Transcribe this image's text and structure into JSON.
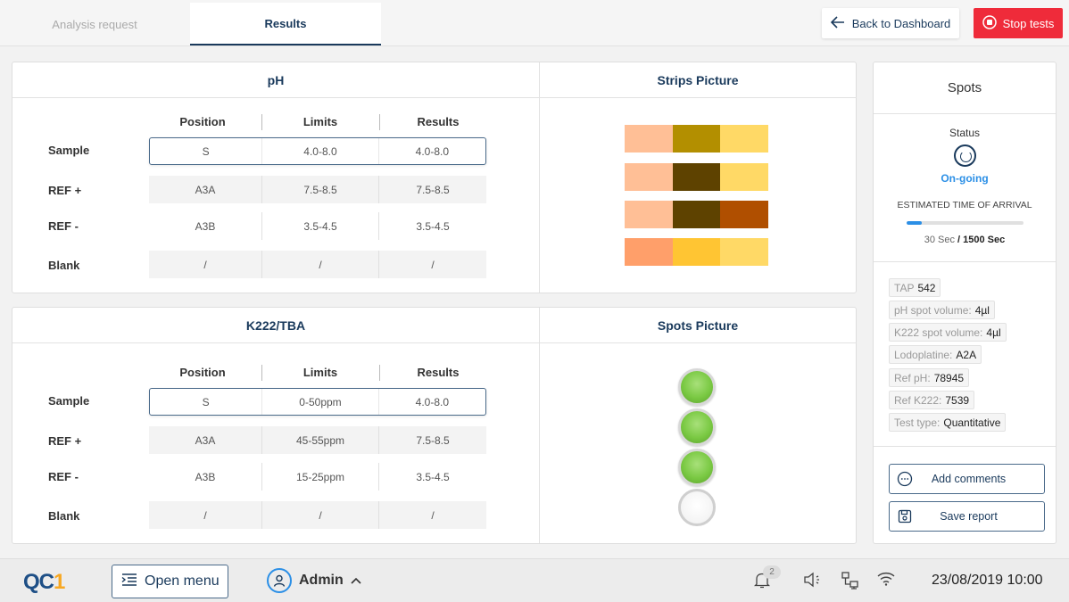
{
  "tabs": {
    "analysis_request": "Analysis request",
    "results": "Results"
  },
  "actions": {
    "back": "Back to Dashboard",
    "stop": "Stop tests"
  },
  "ph_panel": {
    "title": "pH",
    "picture_title": "Strips Picture",
    "columns": [
      "Position",
      "Limits",
      "Results"
    ],
    "rows": [
      {
        "label": "Sample",
        "position": "S",
        "limits": "4.0-8.0",
        "results": "4.0-8.0"
      },
      {
        "label": "REF +",
        "position": "A3A",
        "limits": "7.5-8.5",
        "results": "7.5-8.5"
      },
      {
        "label": "REF -",
        "position": "A3B",
        "limits": "3.5-4.5",
        "results": "3.5-4.5"
      },
      {
        "label": "Blank",
        "position": "/",
        "limits": "/",
        "results": "/"
      }
    ],
    "strip_colors": [
      [
        "#ffbf96",
        "#b38f00",
        "#ffd966"
      ],
      [
        "#ffbf96",
        "#5e4200",
        "#ffd966"
      ],
      [
        "#ffbf96",
        "#5e4200",
        "#b04f00"
      ],
      [
        "#ff9f6a",
        "#ffc533",
        "#ffd966"
      ]
    ]
  },
  "k_panel": {
    "title": "K222/TBA",
    "picture_title": "Spots Picture",
    "columns": [
      "Position",
      "Limits",
      "Results"
    ],
    "rows": [
      {
        "label": "Sample",
        "position": "S",
        "limits": "0-50ppm",
        "results": "4.0-8.0"
      },
      {
        "label": "REF +",
        "position": "A3A",
        "limits": "45-55ppm",
        "results": "7.5-8.5"
      },
      {
        "label": "REF -",
        "position": "A3B",
        "limits": "15-25ppm",
        "results": "3.5-4.5"
      },
      {
        "label": "Blank",
        "position": "/",
        "limits": "/",
        "results": "/"
      }
    ],
    "spots": [
      "green",
      "green",
      "green",
      "empty"
    ]
  },
  "spots": {
    "title": "Spots",
    "status_label": "Status",
    "status_value": "On-going",
    "eta_label": "ESTIMATED TIME OF ARRIVAL",
    "progress": 0.02,
    "time_current": "30 Sec",
    "time_sep": " / ",
    "time_total": "1500 Sec",
    "info": [
      {
        "label": "TAP",
        "value": "542"
      },
      {
        "label": "pH spot volume:",
        "value": "4µl"
      },
      {
        "label": "K222 spot volume:",
        "value": "4µl"
      },
      {
        "label": "Lodoplatine:",
        "value": "A2A"
      },
      {
        "label": "Ref pH:",
        "value": "78945"
      },
      {
        "label": "Ref K222:",
        "value": "7539"
      },
      {
        "label": "Test type:",
        "value": "Quantitative"
      }
    ],
    "add_comments": "Add comments",
    "save_report": "Save report"
  },
  "bottombar": {
    "logo_main": "QC",
    "logo_one": "1",
    "open_menu": "Open menu",
    "user": "Admin",
    "notifications": "2",
    "datetime": "23/08/2019  10:00"
  }
}
